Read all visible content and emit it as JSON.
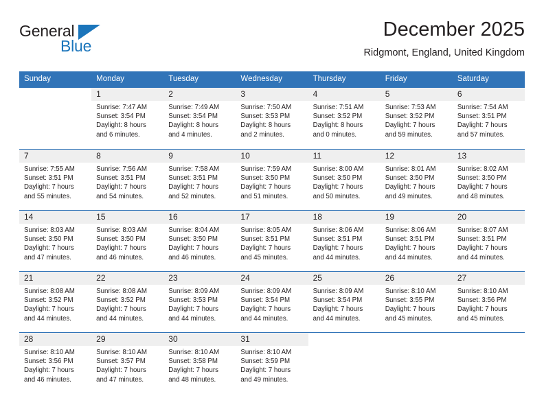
{
  "brand": {
    "line1": "General",
    "line2": "Blue",
    "triangle_icon": "blue-triangle-icon",
    "accent_color": "#1b75bb"
  },
  "header": {
    "title": "December 2025",
    "subtitle": "Ridgmont, England, United Kingdom"
  },
  "theme": {
    "header_blue": "#3174b8",
    "day_band_gray": "#efefef",
    "text_color": "#231f20"
  },
  "weekdays": [
    "Sunday",
    "Monday",
    "Tuesday",
    "Wednesday",
    "Thursday",
    "Friday",
    "Saturday"
  ],
  "weeks": [
    [
      {
        "day": "",
        "sunrise": "",
        "sunset": "",
        "daylight_1": "",
        "daylight_2": ""
      },
      {
        "day": "1",
        "sunrise": "Sunrise: 7:47 AM",
        "sunset": "Sunset: 3:54 PM",
        "daylight_1": "Daylight: 8 hours",
        "daylight_2": "and 6 minutes."
      },
      {
        "day": "2",
        "sunrise": "Sunrise: 7:49 AM",
        "sunset": "Sunset: 3:54 PM",
        "daylight_1": "Daylight: 8 hours",
        "daylight_2": "and 4 minutes."
      },
      {
        "day": "3",
        "sunrise": "Sunrise: 7:50 AM",
        "sunset": "Sunset: 3:53 PM",
        "daylight_1": "Daylight: 8 hours",
        "daylight_2": "and 2 minutes."
      },
      {
        "day": "4",
        "sunrise": "Sunrise: 7:51 AM",
        "sunset": "Sunset: 3:52 PM",
        "daylight_1": "Daylight: 8 hours",
        "daylight_2": "and 0 minutes."
      },
      {
        "day": "5",
        "sunrise": "Sunrise: 7:53 AM",
        "sunset": "Sunset: 3:52 PM",
        "daylight_1": "Daylight: 7 hours",
        "daylight_2": "and 59 minutes."
      },
      {
        "day": "6",
        "sunrise": "Sunrise: 7:54 AM",
        "sunset": "Sunset: 3:51 PM",
        "daylight_1": "Daylight: 7 hours",
        "daylight_2": "and 57 minutes."
      }
    ],
    [
      {
        "day": "7",
        "sunrise": "Sunrise: 7:55 AM",
        "sunset": "Sunset: 3:51 PM",
        "daylight_1": "Daylight: 7 hours",
        "daylight_2": "and 55 minutes."
      },
      {
        "day": "8",
        "sunrise": "Sunrise: 7:56 AM",
        "sunset": "Sunset: 3:51 PM",
        "daylight_1": "Daylight: 7 hours",
        "daylight_2": "and 54 minutes."
      },
      {
        "day": "9",
        "sunrise": "Sunrise: 7:58 AM",
        "sunset": "Sunset: 3:51 PM",
        "daylight_1": "Daylight: 7 hours",
        "daylight_2": "and 52 minutes."
      },
      {
        "day": "10",
        "sunrise": "Sunrise: 7:59 AM",
        "sunset": "Sunset: 3:50 PM",
        "daylight_1": "Daylight: 7 hours",
        "daylight_2": "and 51 minutes."
      },
      {
        "day": "11",
        "sunrise": "Sunrise: 8:00 AM",
        "sunset": "Sunset: 3:50 PM",
        "daylight_1": "Daylight: 7 hours",
        "daylight_2": "and 50 minutes."
      },
      {
        "day": "12",
        "sunrise": "Sunrise: 8:01 AM",
        "sunset": "Sunset: 3:50 PM",
        "daylight_1": "Daylight: 7 hours",
        "daylight_2": "and 49 minutes."
      },
      {
        "day": "13",
        "sunrise": "Sunrise: 8:02 AM",
        "sunset": "Sunset: 3:50 PM",
        "daylight_1": "Daylight: 7 hours",
        "daylight_2": "and 48 minutes."
      }
    ],
    [
      {
        "day": "14",
        "sunrise": "Sunrise: 8:03 AM",
        "sunset": "Sunset: 3:50 PM",
        "daylight_1": "Daylight: 7 hours",
        "daylight_2": "and 47 minutes."
      },
      {
        "day": "15",
        "sunrise": "Sunrise: 8:03 AM",
        "sunset": "Sunset: 3:50 PM",
        "daylight_1": "Daylight: 7 hours",
        "daylight_2": "and 46 minutes."
      },
      {
        "day": "16",
        "sunrise": "Sunrise: 8:04 AM",
        "sunset": "Sunset: 3:50 PM",
        "daylight_1": "Daylight: 7 hours",
        "daylight_2": "and 46 minutes."
      },
      {
        "day": "17",
        "sunrise": "Sunrise: 8:05 AM",
        "sunset": "Sunset: 3:51 PM",
        "daylight_1": "Daylight: 7 hours",
        "daylight_2": "and 45 minutes."
      },
      {
        "day": "18",
        "sunrise": "Sunrise: 8:06 AM",
        "sunset": "Sunset: 3:51 PM",
        "daylight_1": "Daylight: 7 hours",
        "daylight_2": "and 44 minutes."
      },
      {
        "day": "19",
        "sunrise": "Sunrise: 8:06 AM",
        "sunset": "Sunset: 3:51 PM",
        "daylight_1": "Daylight: 7 hours",
        "daylight_2": "and 44 minutes."
      },
      {
        "day": "20",
        "sunrise": "Sunrise: 8:07 AM",
        "sunset": "Sunset: 3:51 PM",
        "daylight_1": "Daylight: 7 hours",
        "daylight_2": "and 44 minutes."
      }
    ],
    [
      {
        "day": "21",
        "sunrise": "Sunrise: 8:08 AM",
        "sunset": "Sunset: 3:52 PM",
        "daylight_1": "Daylight: 7 hours",
        "daylight_2": "and 44 minutes."
      },
      {
        "day": "22",
        "sunrise": "Sunrise: 8:08 AM",
        "sunset": "Sunset: 3:52 PM",
        "daylight_1": "Daylight: 7 hours",
        "daylight_2": "and 44 minutes."
      },
      {
        "day": "23",
        "sunrise": "Sunrise: 8:09 AM",
        "sunset": "Sunset: 3:53 PM",
        "daylight_1": "Daylight: 7 hours",
        "daylight_2": "and 44 minutes."
      },
      {
        "day": "24",
        "sunrise": "Sunrise: 8:09 AM",
        "sunset": "Sunset: 3:54 PM",
        "daylight_1": "Daylight: 7 hours",
        "daylight_2": "and 44 minutes."
      },
      {
        "day": "25",
        "sunrise": "Sunrise: 8:09 AM",
        "sunset": "Sunset: 3:54 PM",
        "daylight_1": "Daylight: 7 hours",
        "daylight_2": "and 44 minutes."
      },
      {
        "day": "26",
        "sunrise": "Sunrise: 8:10 AM",
        "sunset": "Sunset: 3:55 PM",
        "daylight_1": "Daylight: 7 hours",
        "daylight_2": "and 45 minutes."
      },
      {
        "day": "27",
        "sunrise": "Sunrise: 8:10 AM",
        "sunset": "Sunset: 3:56 PM",
        "daylight_1": "Daylight: 7 hours",
        "daylight_2": "and 45 minutes."
      }
    ],
    [
      {
        "day": "28",
        "sunrise": "Sunrise: 8:10 AM",
        "sunset": "Sunset: 3:56 PM",
        "daylight_1": "Daylight: 7 hours",
        "daylight_2": "and 46 minutes."
      },
      {
        "day": "29",
        "sunrise": "Sunrise: 8:10 AM",
        "sunset": "Sunset: 3:57 PM",
        "daylight_1": "Daylight: 7 hours",
        "daylight_2": "and 47 minutes."
      },
      {
        "day": "30",
        "sunrise": "Sunrise: 8:10 AM",
        "sunset": "Sunset: 3:58 PM",
        "daylight_1": "Daylight: 7 hours",
        "daylight_2": "and 48 minutes."
      },
      {
        "day": "31",
        "sunrise": "Sunrise: 8:10 AM",
        "sunset": "Sunset: 3:59 PM",
        "daylight_1": "Daylight: 7 hours",
        "daylight_2": "and 49 minutes."
      },
      {
        "day": "",
        "sunrise": "",
        "sunset": "",
        "daylight_1": "",
        "daylight_2": ""
      },
      {
        "day": "",
        "sunrise": "",
        "sunset": "",
        "daylight_1": "",
        "daylight_2": ""
      },
      {
        "day": "",
        "sunrise": "",
        "sunset": "",
        "daylight_1": "",
        "daylight_2": ""
      }
    ]
  ]
}
